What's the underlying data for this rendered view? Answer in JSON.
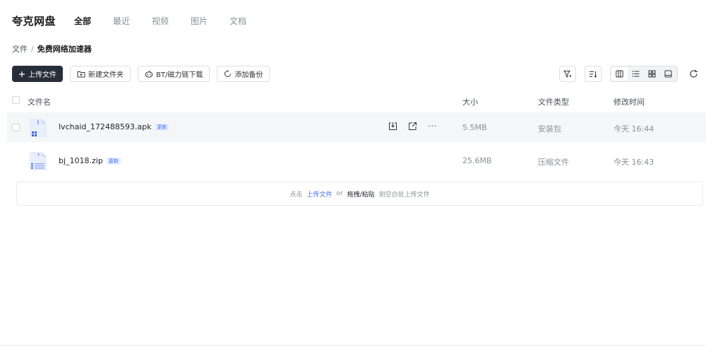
{
  "app": {
    "brand": "夸克网盘"
  },
  "nav": {
    "tabs": [
      "全部",
      "最近",
      "视频",
      "图片",
      "文档"
    ]
  },
  "breadcrumb": {
    "root": "文件",
    "separator": "/",
    "current": "免费网络加速器"
  },
  "toolbar": {
    "upload": "上传文件",
    "new_folder": "新建文件夹",
    "bt": "BT/磁力链下载",
    "backup": "添加备份"
  },
  "columns": {
    "name": "文件名",
    "size": "大小",
    "type": "文件类型",
    "modified": "修改时间"
  },
  "files": [
    {
      "name": "lvchaid_172488593.apk",
      "badge": "更新",
      "size": "5.5MB",
      "type": "安装包",
      "modified": "今天 16:44",
      "icon": "apk-file-icon"
    },
    {
      "name": "bj_1018.zip",
      "badge": "更新",
      "size": "25.6MB",
      "type": "压缩文件",
      "modified": "今天 16:43",
      "icon": "zip-file-icon"
    }
  ],
  "row_actions": {
    "more": "···"
  },
  "dropzone": {
    "prefix": "点击",
    "link": "上传文件",
    "or": "or",
    "drag": "拖拽/粘贴",
    "suffix": "到空白处上传文件"
  },
  "colors": {
    "primary": "#282d3a",
    "accent": "#3d6cf0",
    "muted": "#8a8f99",
    "hover_row": "#f5f6f7"
  }
}
